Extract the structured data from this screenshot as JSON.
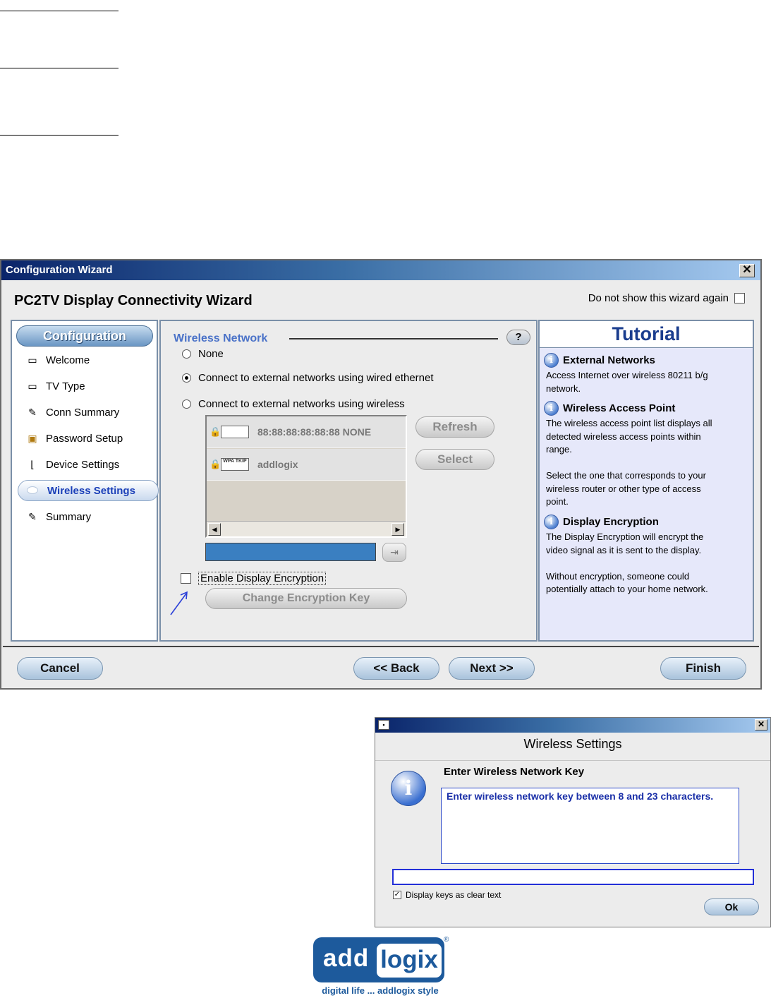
{
  "main_window": {
    "title": "Configuration Wizard",
    "close_glyph": "✕",
    "heading": "PC2TV Display Connectivity Wizard",
    "dont_show_label": "Do not show this wizard again",
    "dont_show_checked": false
  },
  "nav": {
    "header": "Configuration",
    "items": [
      {
        "label": "Welcome",
        "icon": "tv-icon"
      },
      {
        "label": "TV Type",
        "icon": "tv-icon"
      },
      {
        "label": "Conn Summary",
        "icon": "checklist-icon"
      },
      {
        "label": "Password Setup",
        "icon": "lock-icon"
      },
      {
        "label": "Device Settings",
        "icon": "device-icon"
      },
      {
        "label": "Wireless Settings",
        "icon": "wireless-icon",
        "active": true
      },
      {
        "label": "Summary",
        "icon": "checklist-icon"
      }
    ]
  },
  "wireless": {
    "section_title": "Wireless Network",
    "help_glyph": "?",
    "options": [
      {
        "label": "None",
        "selected": false
      },
      {
        "label": "Connect to external networks using wired ethernet",
        "selected": true
      },
      {
        "label": "Connect to external networks using wireless",
        "selected": false
      }
    ],
    "access_points": [
      {
        "label": "88:88:88:88:88:88  NONE",
        "badge": ""
      },
      {
        "label": "addlogix",
        "badge": "WPA TKIP"
      }
    ],
    "refresh_label": "Refresh",
    "select_label": "Select",
    "encryption_label": "Enable Display Encryption",
    "encryption_checked": false,
    "change_key_label": "Change Encryption Key"
  },
  "tutorial": {
    "title": "Tutorial",
    "sections": [
      {
        "heading": "External Networks",
        "text": "Access Internet over wireless 80211 b/g\nnetwork."
      },
      {
        "heading": "Wireless Access Point",
        "text": "The wireless access point list displays all\ndetected wireless access points within\nrange.\n\nSelect the one that corresponds to your\nwireless router or other type of access\npoint."
      },
      {
        "heading": "Display Encryption",
        "text": "The Display Encryption will encrypt the\nvideo signal as it is sent to the display.\n\nWithout encryption, someone could\npotentially attach to your home network."
      }
    ]
  },
  "footer": {
    "cancel_label": "Cancel",
    "back_label": "<< Back",
    "next_label": "Next  >>",
    "finish_label": "Finish"
  },
  "dialog": {
    "title": "Wireless Settings",
    "subtitle": "Enter Wireless Network Key",
    "message": "Enter wireless network key between 8 and 23 characters.",
    "key_value": "",
    "clear_text_label": "Display keys as clear text",
    "clear_text_checked": true,
    "ok_label": "Ok"
  },
  "logo": {
    "part1": "add",
    "part2": "logix",
    "reg": "®",
    "tagline": "digital life ... addlogix style"
  },
  "colors": {
    "accent": "#4a72c8",
    "title_bar": "#0a246a",
    "tutorial_bg": "#e6e8fa",
    "brand": "#1d5a9c"
  }
}
